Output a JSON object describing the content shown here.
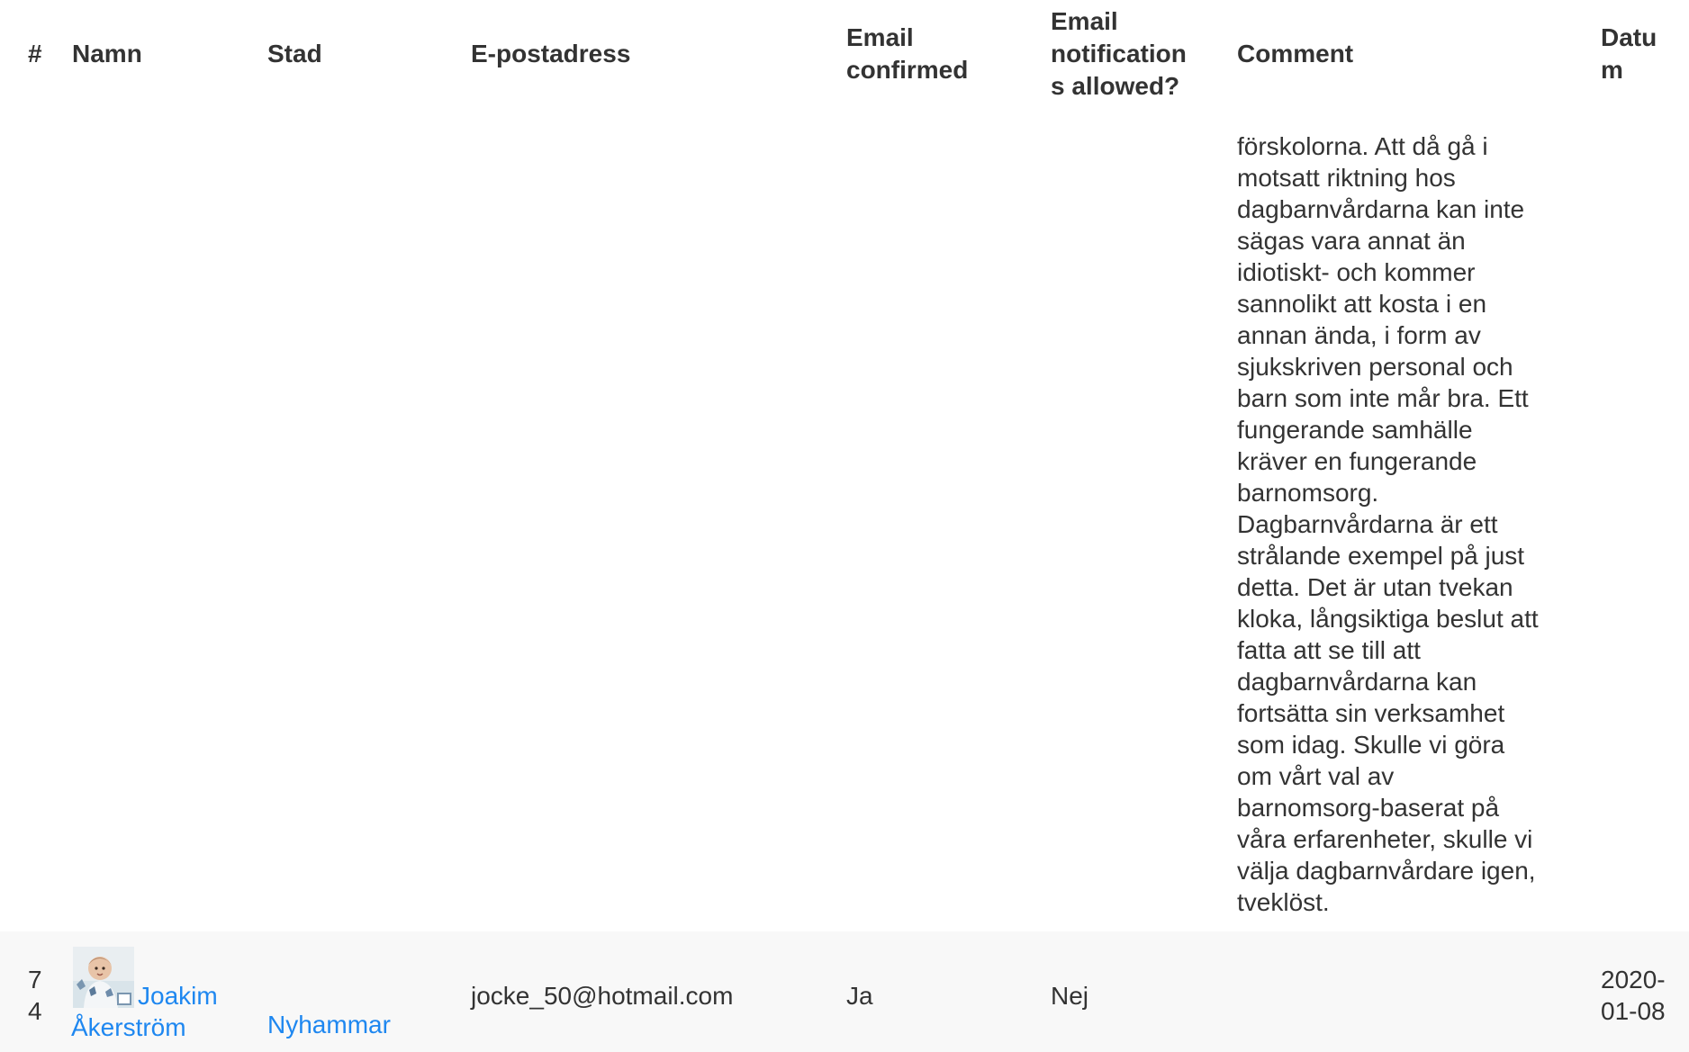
{
  "table": {
    "headers": {
      "number": "#",
      "name": "Namn",
      "city": "Stad",
      "email": "E-postadress",
      "email_confirmed_lines": [
        "Email",
        "confirmed"
      ],
      "notifications_lines": [
        "Email",
        "notification",
        "s allowed?"
      ],
      "comment": "Comment",
      "date_lines": [
        "Datu",
        "m"
      ]
    },
    "previous_comment_lines": [
      "förskolorna. Att då gå i",
      "motsatt riktning hos",
      "dagbarnvårdarna kan inte",
      "sägas vara annat än",
      "idiotiskt- och kommer",
      "sannolikt att kosta i en",
      "annan ända, i form av",
      "sjukskriven personal och",
      "barn som inte mår bra. Ett",
      "fungerande samhälle",
      "kräver en fungerande",
      "barnomsorg.",
      "Dagbarnvårdarna är ett",
      "strålande exempel på just",
      "detta. Det är utan tvekan",
      "kloka, långsiktiga beslut att",
      "fatta att se till att",
      "dagbarnvårdarna kan",
      "fortsätta sin verksamhet",
      "som idag. Skulle vi göra",
      "om vårt val av",
      "barnomsorg-baserat på",
      "våra erfarenheter, skulle vi",
      "välja dagbarnvårdare igen,",
      "tveklöst."
    ],
    "rows": [
      {
        "number_lines": [
          "7",
          "4"
        ],
        "name_lines": [
          "Joakim",
          "Åkerström"
        ],
        "city": "Nyhammar",
        "email": "jocke_50@hotmail.com",
        "email_confirmed": "Ja",
        "notifications_allowed": "Nej",
        "comment": "",
        "date_lines": [
          "2020-",
          "01-08"
        ]
      }
    ]
  },
  "colors": {
    "text": "#333333",
    "link": "#1e87f0",
    "striped_row": "#f8f8f8",
    "background": "#ffffff"
  },
  "icons": {
    "avatar": "user-avatar-photo"
  }
}
